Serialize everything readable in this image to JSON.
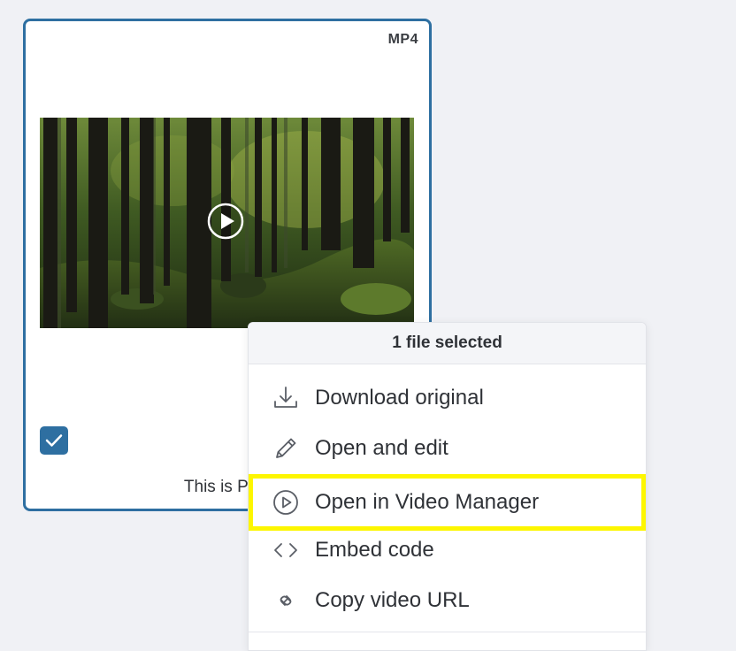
{
  "card": {
    "file_type": "MP4",
    "caption": "This is Pola",
    "selected": true
  },
  "menu": {
    "header": "1 file selected",
    "items": [
      {
        "label": "Download original",
        "icon": "download-icon"
      },
      {
        "label": "Open and edit",
        "icon": "pencil-icon"
      },
      {
        "label": "Open in Video Manager",
        "icon": "play-circle-icon",
        "highlighted": true
      },
      {
        "label": "Embed code",
        "icon": "code-icon"
      },
      {
        "label": "Copy video URL",
        "icon": "link-icon"
      }
    ]
  },
  "colors": {
    "accent": "#2e6fa1",
    "highlight": "#fdf600",
    "background": "#f0f1f5"
  }
}
